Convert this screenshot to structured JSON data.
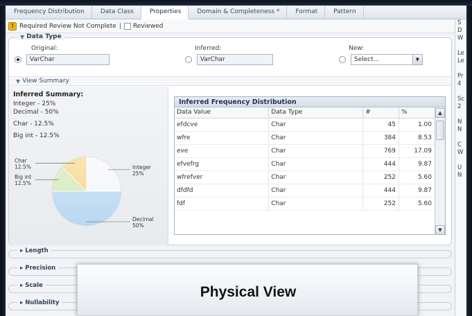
{
  "tabs": [
    {
      "label": "Frequency Distribution"
    },
    {
      "label": "Data Class"
    },
    {
      "label": "Properties"
    },
    {
      "label": "Domain & Completeness *"
    },
    {
      "label": "Format"
    },
    {
      "label": "Pattern"
    }
  ],
  "status": {
    "warning_icon": "!",
    "required_text": "Required Review Not Complete",
    "separator": "|",
    "reviewed_label": "Reviewed"
  },
  "data_type": {
    "legend": "Data Type",
    "original_label": "Original:",
    "original_value": "VarChar",
    "inferred_label": "Inferred:",
    "inferred_value": "VarChar",
    "new_label": "New:",
    "new_value": "Select..."
  },
  "view_summary": {
    "label": "View Summary"
  },
  "summary": {
    "title": "Inferred Summary:",
    "lines": [
      "Integer - 25%",
      "Decimal - 50%",
      "Char - 12.5%",
      "Big int - 12.5%"
    ]
  },
  "chart_data": {
    "type": "pie",
    "categories": [
      "Integer",
      "Decimal",
      "Big int",
      "Char"
    ],
    "values": [
      25,
      50,
      12.5,
      12.5
    ],
    "labels": [
      {
        "name": "Integer",
        "pct": "25%"
      },
      {
        "name": "Decimal",
        "pct": "50%"
      },
      {
        "name": "Big int",
        "pct": "12.5%"
      },
      {
        "name": "Char",
        "pct": "12.5%"
      }
    ],
    "colors": [
      "#f5f6f8",
      "#b9d8f2",
      "#d4e8b7",
      "#f6d58a"
    ]
  },
  "freq_table": {
    "title": "Inferred Frequency Distribution",
    "headers": [
      "Data Value",
      "Data Type",
      "#",
      "%"
    ],
    "rows": [
      [
        "efdcve",
        "Char",
        "45",
        "1.00"
      ],
      [
        "wfre",
        "Char",
        "384",
        "8.53"
      ],
      [
        "eve",
        "Char",
        "769",
        "17.09"
      ],
      [
        "efvefrg",
        "Char",
        "444",
        "9.87"
      ],
      [
        "wfrefver",
        "Char",
        "252",
        "5.60"
      ],
      [
        "dfdfd",
        "Char",
        "444",
        "9.87"
      ],
      [
        "fdf",
        "Char",
        "252",
        "5.60"
      ]
    ]
  },
  "sections": [
    {
      "label": "Length"
    },
    {
      "label": "Precision"
    },
    {
      "label": "Scale"
    },
    {
      "label": "Nullability"
    }
  ],
  "right_panel": {
    "lines": [
      "S",
      "D",
      "W",
      "",
      "Le",
      "Le",
      "",
      "Pr",
      "4",
      "",
      "Sc",
      "2",
      "",
      "N",
      "N",
      "",
      "C",
      "W",
      "",
      "U",
      "N"
    ]
  },
  "banner": {
    "text": "Physical View"
  }
}
